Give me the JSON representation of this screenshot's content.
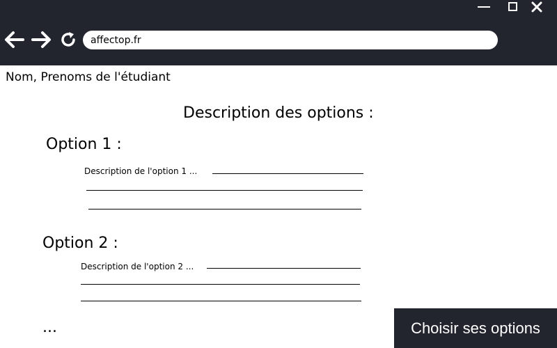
{
  "browser": {
    "url": "affectop.fr",
    "icons": {
      "minimize": "minimize-icon",
      "maximize": "maximize-icon",
      "close": "close-icon",
      "back": "arrow-left-icon",
      "forward": "arrow-right-icon",
      "reload": "reload-icon"
    },
    "chrome_color": "#22252e"
  },
  "page": {
    "student_name": "Nom, Prenoms de l'étudiant",
    "title": "Description des options :",
    "options": [
      {
        "heading": "Option 1 :",
        "description": "Description de l'option 1 ..."
      },
      {
        "heading": "Option 2 :",
        "description": "Description de l'option 2 ..."
      }
    ],
    "more": "...",
    "choose_button": "Choisir ses options"
  }
}
